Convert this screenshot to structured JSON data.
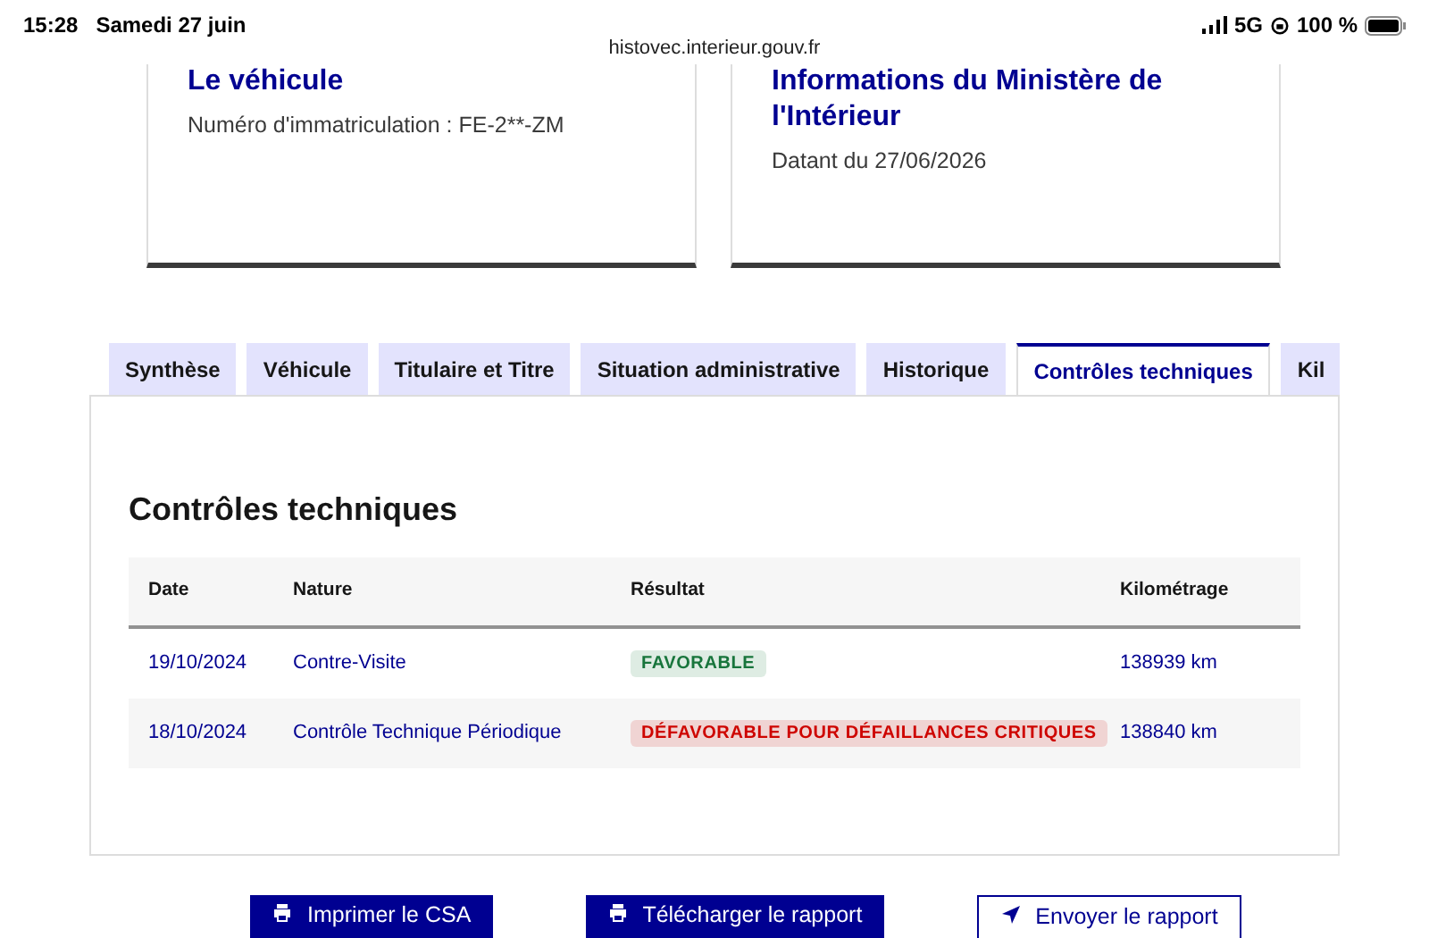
{
  "status_bar": {
    "time": "15:28",
    "date": "Samedi 27 juin",
    "network": "5G",
    "battery": "100 %",
    "url": "histovec.interieur.gouv.fr"
  },
  "cards": [
    {
      "title": "Le véhicule",
      "text": "Numéro d'immatriculation : FE-2**-ZM"
    },
    {
      "title": "Informations du Ministère de l'Intérieur",
      "text": "Datant du 27/06/2026"
    }
  ],
  "tabs": [
    {
      "label": "Synthèse",
      "selected": false
    },
    {
      "label": "Véhicule",
      "selected": false
    },
    {
      "label": "Titulaire et Titre",
      "selected": false
    },
    {
      "label": "Situation administrative",
      "selected": false
    },
    {
      "label": "Historique",
      "selected": false
    },
    {
      "label": "Contrôles techniques",
      "selected": true
    },
    {
      "label": "Kil",
      "selected": false
    }
  ],
  "section_title": "Contrôles techniques",
  "table": {
    "columns": [
      "Date",
      "Nature",
      "Résultat",
      "Kilométrage"
    ],
    "rows": [
      {
        "date": "19/10/2024",
        "nature": "Contre-Visite",
        "result": "FAVORABLE",
        "color": "#18753c",
        "km": "138939 km"
      },
      {
        "date": "18/10/2024",
        "nature": "Contrôle Technique Périodique",
        "result": "DÉFAVORABLE POUR DÉFAILLANCES CRITIQUES",
        "color": "#ce0500",
        "km": "138840 km"
      }
    ]
  },
  "buttons": [
    {
      "label": "Imprimer le CSA",
      "kind": "primary"
    },
    {
      "label": "Télécharger le rapport",
      "kind": "primary"
    },
    {
      "label": "Envoyer le rapport",
      "kind": "secondary"
    }
  ]
}
